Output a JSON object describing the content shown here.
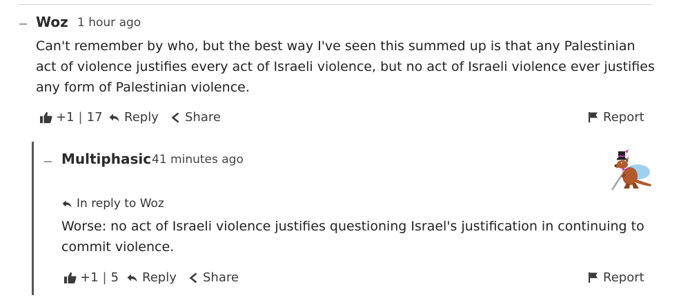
{
  "comments": [
    {
      "author": "Woz",
      "time": "1 hour ago",
      "text": "Can't remember by who, but the best way I've seen this summed up is that any Palestinian act of violence justifies every act of Israeli violence, but no act of Israeli violence ever justifies any form of Palestinian violence.",
      "like_label": "+1",
      "score": "17",
      "reply_label": "Reply",
      "share_label": "Share",
      "report_label": "Report"
    },
    {
      "author": "Multiphasic",
      "time": "41 minutes ago",
      "in_reply_to": "In reply to Woz",
      "text": "Worse: no act of Israeli violence justifies questioning Israel's justification in continuing to commit violence.",
      "like_label": "+1",
      "score": "5",
      "reply_label": "Reply",
      "share_label": "Share",
      "report_label": "Report"
    }
  ],
  "icons": [
    "collapse-icon",
    "thumbs-up-icon",
    "reply-arrow-icon",
    "share-icon",
    "flag-icon",
    "avatar-kangaroo-top-hat"
  ],
  "colors": {
    "text": "#222222",
    "muted": "#444444",
    "thread_line": "#555555",
    "divider": "#d2d2d2"
  }
}
